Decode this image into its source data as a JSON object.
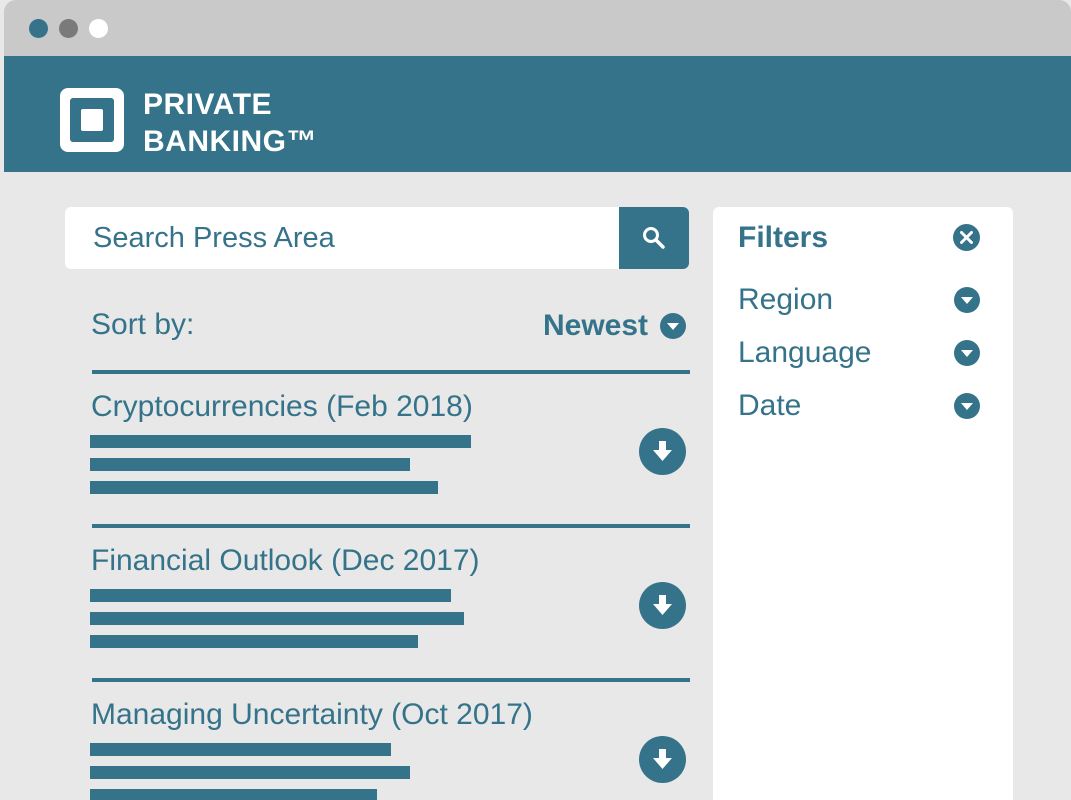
{
  "brand": {
    "line1": "PRIVATE",
    "line2": "BANKING™"
  },
  "search": {
    "placeholder": "Search Press Area",
    "icon": "search-icon"
  },
  "sort": {
    "label": "Sort by:",
    "selected": "Newest"
  },
  "items": [
    {
      "title": "Cryptocurrencies (Feb 2018)"
    },
    {
      "title": "Financial Outlook (Dec 2017)"
    },
    {
      "title": "Managing Uncertainty (Oct 2017)"
    }
  ],
  "filters": {
    "title": "Filters",
    "options": [
      {
        "label": "Region"
      },
      {
        "label": "Language"
      },
      {
        "label": "Date"
      }
    ]
  },
  "colors": {
    "brand": "#35738a",
    "background": "#e8e8e8",
    "chrome": "#c9c9c9",
    "panel": "#ffffff"
  }
}
